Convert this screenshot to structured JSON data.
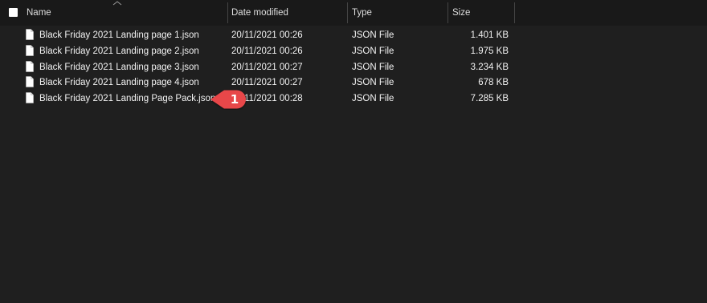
{
  "columns": {
    "name": "Name",
    "date_modified": "Date modified",
    "type": "Type",
    "size": "Size"
  },
  "files": [
    {
      "name": "Black Friday 2021 Landing page 1.json",
      "date": "20/11/2021 00:26",
      "type": "JSON File",
      "size": "1.401 KB"
    },
    {
      "name": "Black Friday 2021 Landing page 2.json",
      "date": "20/11/2021 00:26",
      "type": "JSON File",
      "size": "1.975 KB"
    },
    {
      "name": "Black Friday 2021 Landing page 3.json",
      "date": "20/11/2021 00:27",
      "type": "JSON File",
      "size": "3.234 KB"
    },
    {
      "name": "Black Friday 2021 Landing page 4.json",
      "date": "20/11/2021 00:27",
      "type": "JSON File",
      "size": "678 KB"
    },
    {
      "name": "Black Friday 2021 Landing Page Pack.json",
      "date": "20/11/2021 00:28",
      "type": "JSON File",
      "size": "7.285 KB"
    }
  ],
  "callout": {
    "number": "1",
    "color": "#e8474a"
  },
  "icons": {
    "header_checkbox": "checkbox-icon",
    "sort_indicator": "sort-caret-icon",
    "file": "file-icon"
  },
  "colors": {
    "background": "#1f1f1f",
    "header_background": "#191919",
    "text": "#f2f2f2",
    "callout": "#e8474a"
  }
}
